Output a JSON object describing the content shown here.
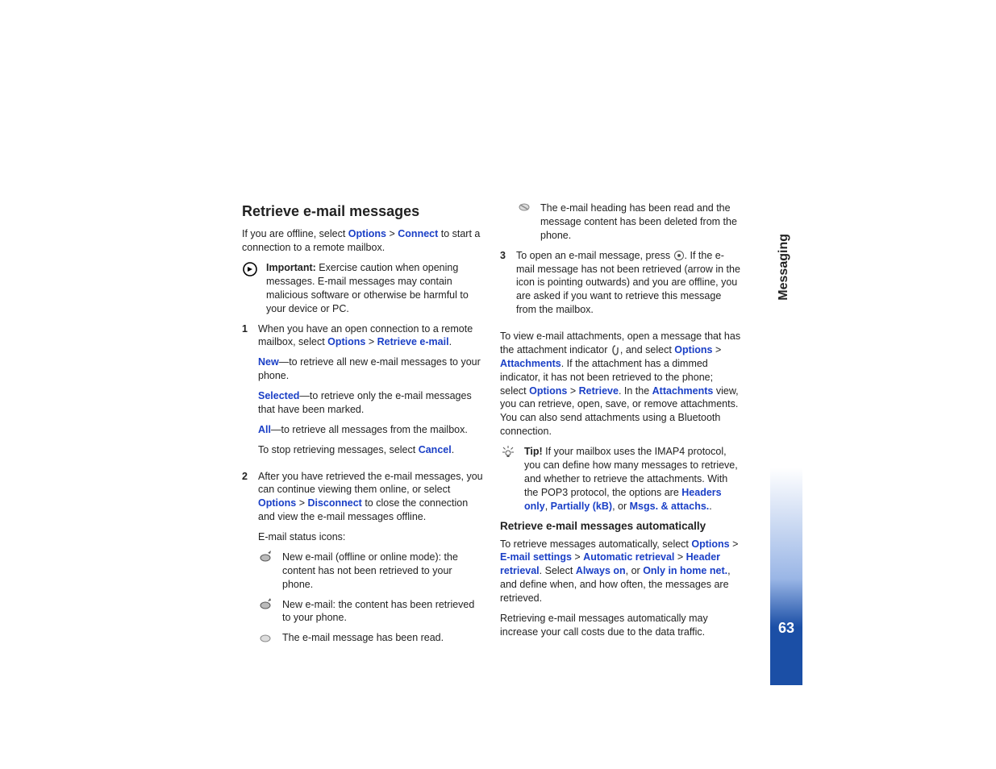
{
  "side": {
    "section": "Messaging",
    "page": "63"
  },
  "c1": {
    "h": "Retrieve e-mail messages",
    "intro_a": "If you are offline, select ",
    "intro_opt": "Options",
    "intro_gt": " > ",
    "intro_con": "Connect",
    "intro_b": " to start a connection to a remote mailbox.",
    "imp_label": "Important:",
    "imp_text": " Exercise caution when opening messages. E-mail messages may contain malicious software or otherwise be harmful to your device or PC.",
    "s1_a": "When you have an open connection to a remote mailbox, select ",
    "s1_opt": "Options",
    "s1_gt": " > ",
    "s1_ret": "Retrieve e-mail",
    "s1_b": ".",
    "new_l": "New",
    "new_t": "—to retrieve all new e-mail messages to your phone.",
    "sel_l": "Selected",
    "sel_t": "—to retrieve only the e-mail messages that have been marked.",
    "all_l": "All",
    "all_t": "—to retrieve all messages from the mailbox.",
    "stop_a": "To stop retrieving messages, select ",
    "stop_c": "Cancel",
    "stop_b": ".",
    "s2_a": "After you have retrieved the e-mail messages, you can continue viewing them online, or select ",
    "s2_opt": "Options",
    "s2_gt": " > ",
    "s2_dis": "Disconnect",
    "s2_b": " to close the connection and view the e-mail messages offline.",
    "icons_h": "E-mail status icons:",
    "i1": "New e-mail (offline or online mode): the content has not been retrieved to your phone.",
    "i2": "New e-mail: the content has been retrieved to your phone.",
    "i3": "The e-mail message has been read."
  },
  "c2": {
    "i4": "The e-mail heading has been read and the message content has been deleted from the phone.",
    "s3_a": "To open an e-mail message, press ",
    "s3_b": ". If the e-mail message has not been retrieved (arrow in the icon is pointing outwards) and you are offline, you are asked if you want to retrieve this message from the mailbox.",
    "att_a": "To view e-mail attachments, open a message that has the attachment indicator ",
    "att_b": ", and select ",
    "att_opt": "Options",
    "att_gt": " > ",
    "att_att": "Attachments",
    "att_c": ". If the attachment has a dimmed indicator, it has not been retrieved to the phone; select ",
    "att_opt2": "Options",
    "att_gt2": " > ",
    "att_ret": "Retrieve",
    "att_d": ". In the ",
    "att_view": "Attachments",
    "att_e": " view, you can retrieve, open, save, or remove attachments. You can also send attachments using a Bluetooth connection.",
    "tip_l": "Tip!",
    "tip_a": " If your mailbox uses the IMAP4 protocol, you can define how many messages to retrieve, and whether to retrieve the attachments. With the POP3 protocol, the options are ",
    "tip_h": "Headers only",
    "tip_c1": ", ",
    "tip_p": "Partially (kB)",
    "tip_c2": ", or ",
    "tip_m": "Msgs. & attachs.",
    "tip_b": ".",
    "auto_h": "Retrieve e-mail messages automatically",
    "auto_a": "To retrieve messages automatically, select ",
    "auto_opt": "Options",
    "auto_gt": " > ",
    "auto_es": "E-mail settings",
    "auto_gt2": " > ",
    "auto_ar": "Automatic retrieval",
    "auto_gt3": " > ",
    "auto_hr": "Header retrieval",
    "auto_b": ". Select ",
    "auto_ao": "Always on",
    "auto_c": ", or ",
    "auto_hn": "Only in home net.",
    "auto_d": ", and define when, and how often, the messages are retrieved.",
    "auto_warn": "Retrieving e-mail messages automatically may increase your call costs due to the data traffic."
  }
}
